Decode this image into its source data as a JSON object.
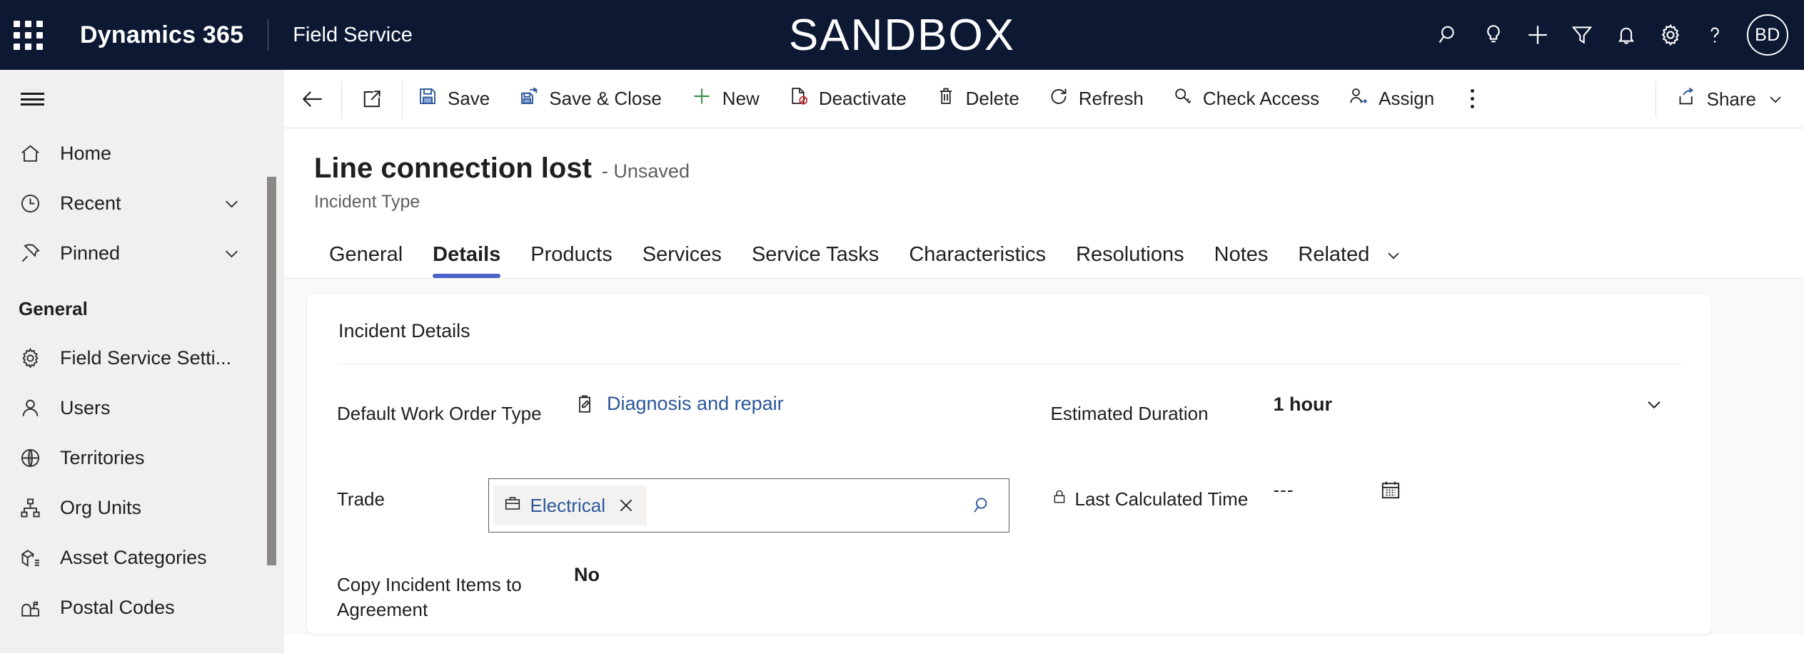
{
  "header": {
    "brand": "Dynamics 365",
    "app_name": "Field Service",
    "environment_banner": "SANDBOX",
    "waffle_label": "app-launcher",
    "icons": [
      {
        "name": "search-icon",
        "label": "Search"
      },
      {
        "name": "lightbulb-icon",
        "label": "Insights"
      },
      {
        "name": "plus-icon",
        "label": "New"
      },
      {
        "name": "filter-icon",
        "label": "Filter"
      },
      {
        "name": "bell-icon",
        "label": "Notifications"
      },
      {
        "name": "gear-icon",
        "label": "Settings"
      },
      {
        "name": "question-icon",
        "label": "Help"
      }
    ],
    "avatar_initials": "BD",
    "background_color": "#0d1833"
  },
  "sidebar": {
    "hamburger_label": "Expand navigation",
    "top_items": [
      {
        "label": "Home",
        "icon": "home-icon",
        "chevron": false
      },
      {
        "label": "Recent",
        "icon": "clock-icon",
        "chevron": true
      },
      {
        "label": "Pinned",
        "icon": "pin-icon",
        "chevron": true
      }
    ],
    "group_label": "General",
    "group_items": [
      {
        "label": "Field Service Setti...",
        "icon": "gear-icon"
      },
      {
        "label": "Users",
        "icon": "person-icon"
      },
      {
        "label": "Territories",
        "icon": "globe-icon"
      },
      {
        "label": "Org Units",
        "icon": "org-chart-icon"
      },
      {
        "label": "Asset Categories",
        "icon": "asset-box-icon"
      },
      {
        "label": "Postal Codes",
        "icon": "mailbox-icon"
      }
    ]
  },
  "commandbar": {
    "back_label": "Back",
    "popout_label": "Open in new window",
    "buttons": [
      {
        "label": "Save",
        "icon": "save-icon"
      },
      {
        "label": "Save & Close",
        "icon": "save-close-icon"
      },
      {
        "label": "New",
        "icon": "plus-icon"
      },
      {
        "label": "Deactivate",
        "icon": "deactivate-icon"
      },
      {
        "label": "Delete",
        "icon": "trash-icon"
      },
      {
        "label": "Refresh",
        "icon": "refresh-icon"
      },
      {
        "label": "Check Access",
        "icon": "key-icon"
      },
      {
        "label": "Assign",
        "icon": "assign-person-icon"
      }
    ],
    "overflow_label": "More commands",
    "share_label": "Share"
  },
  "record": {
    "title": "Line connection lost",
    "status": "- Unsaved",
    "entity": "Incident Type"
  },
  "tabs": {
    "items": [
      {
        "label": "General",
        "active": false
      },
      {
        "label": "Details",
        "active": true
      },
      {
        "label": "Products",
        "active": false
      },
      {
        "label": "Services",
        "active": false
      },
      {
        "label": "Service Tasks",
        "active": false
      },
      {
        "label": "Characteristics",
        "active": false
      },
      {
        "label": "Resolutions",
        "active": false
      },
      {
        "label": "Notes",
        "active": false
      },
      {
        "label": "Related",
        "active": false
      }
    ],
    "active_indicator_color": "#4b62c9"
  },
  "form": {
    "section_title": "Incident Details",
    "left_fields": [
      {
        "label": "Default Work Order Type",
        "value": "Diagnosis and repair",
        "type": "lookup-link",
        "icon": "work-order-type-icon"
      },
      {
        "label": "Trade",
        "value": "Electrical",
        "type": "lookup-input",
        "icon": "briefcase-icon",
        "clear_label": "Remove value",
        "search_label": "Lookup records"
      },
      {
        "label": "Copy Incident Items to Agreement",
        "value": "No",
        "type": "text"
      }
    ],
    "right_fields": [
      {
        "label": "Estimated Duration",
        "value": "1 hour",
        "type": "dropdown",
        "locked": false
      },
      {
        "label": "Last Calculated Time",
        "value": "---",
        "type": "datetime",
        "locked": true,
        "lock_icon": "lock-icon",
        "calendar_icon": "calendar-icon"
      }
    ]
  },
  "colors": {
    "header_bg": "#0d1833",
    "link": "#2b579a",
    "accent": "#4b62c9",
    "page_bg": "#faf9f8",
    "sidebar_bg": "#f0f0f0"
  }
}
